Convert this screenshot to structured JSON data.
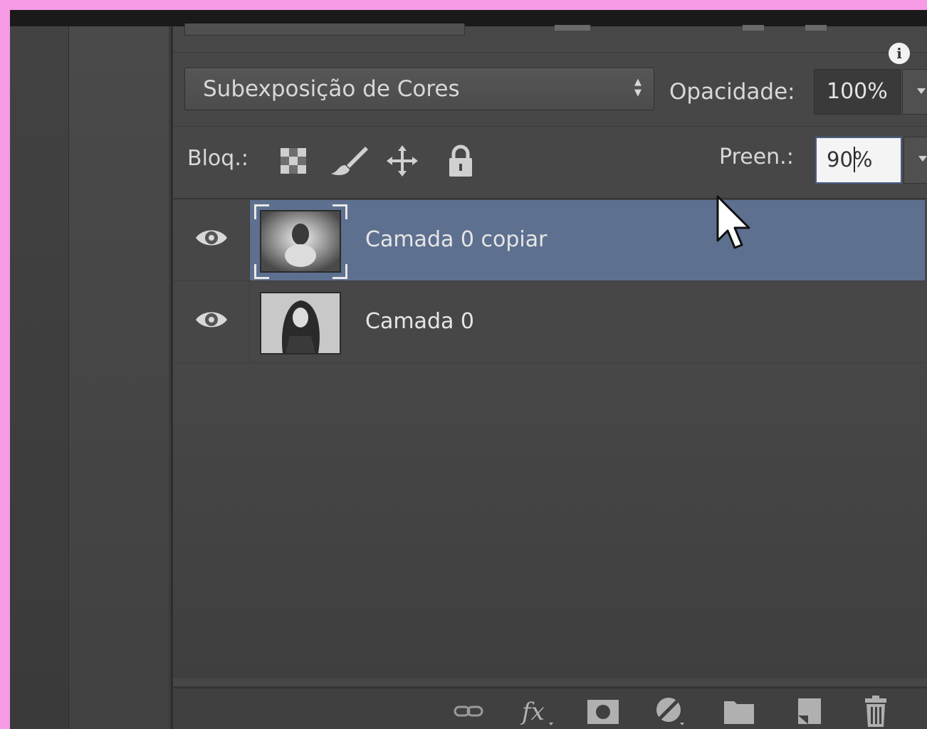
{
  "layers_panel": {
    "blend_mode": "Subexposição de Cores",
    "opacity_label": "Opacidade:",
    "opacity_value": "100%",
    "lock_label": "Bloq.:",
    "fill_label": "Preen.:",
    "fill_value": "90%",
    "layers": [
      {
        "name": "Camada 0 copiar",
        "selected": true,
        "visible": true
      },
      {
        "name": "Camada 0",
        "selected": false,
        "visible": true
      }
    ],
    "lock_icons": [
      "lock-transparent-pixels-icon",
      "lock-image-pixels-icon",
      "lock-position-icon",
      "lock-all-icon"
    ],
    "bottom_icons": [
      "link-layers-icon",
      "layer-style-fx-icon",
      "add-mask-icon",
      "adjustment-layer-icon",
      "new-group-icon",
      "new-layer-icon",
      "delete-layer-icon"
    ],
    "colors": {
      "selection": "#5e708f",
      "panel_bg": "#474747",
      "frame_border": "#f79be6"
    }
  }
}
